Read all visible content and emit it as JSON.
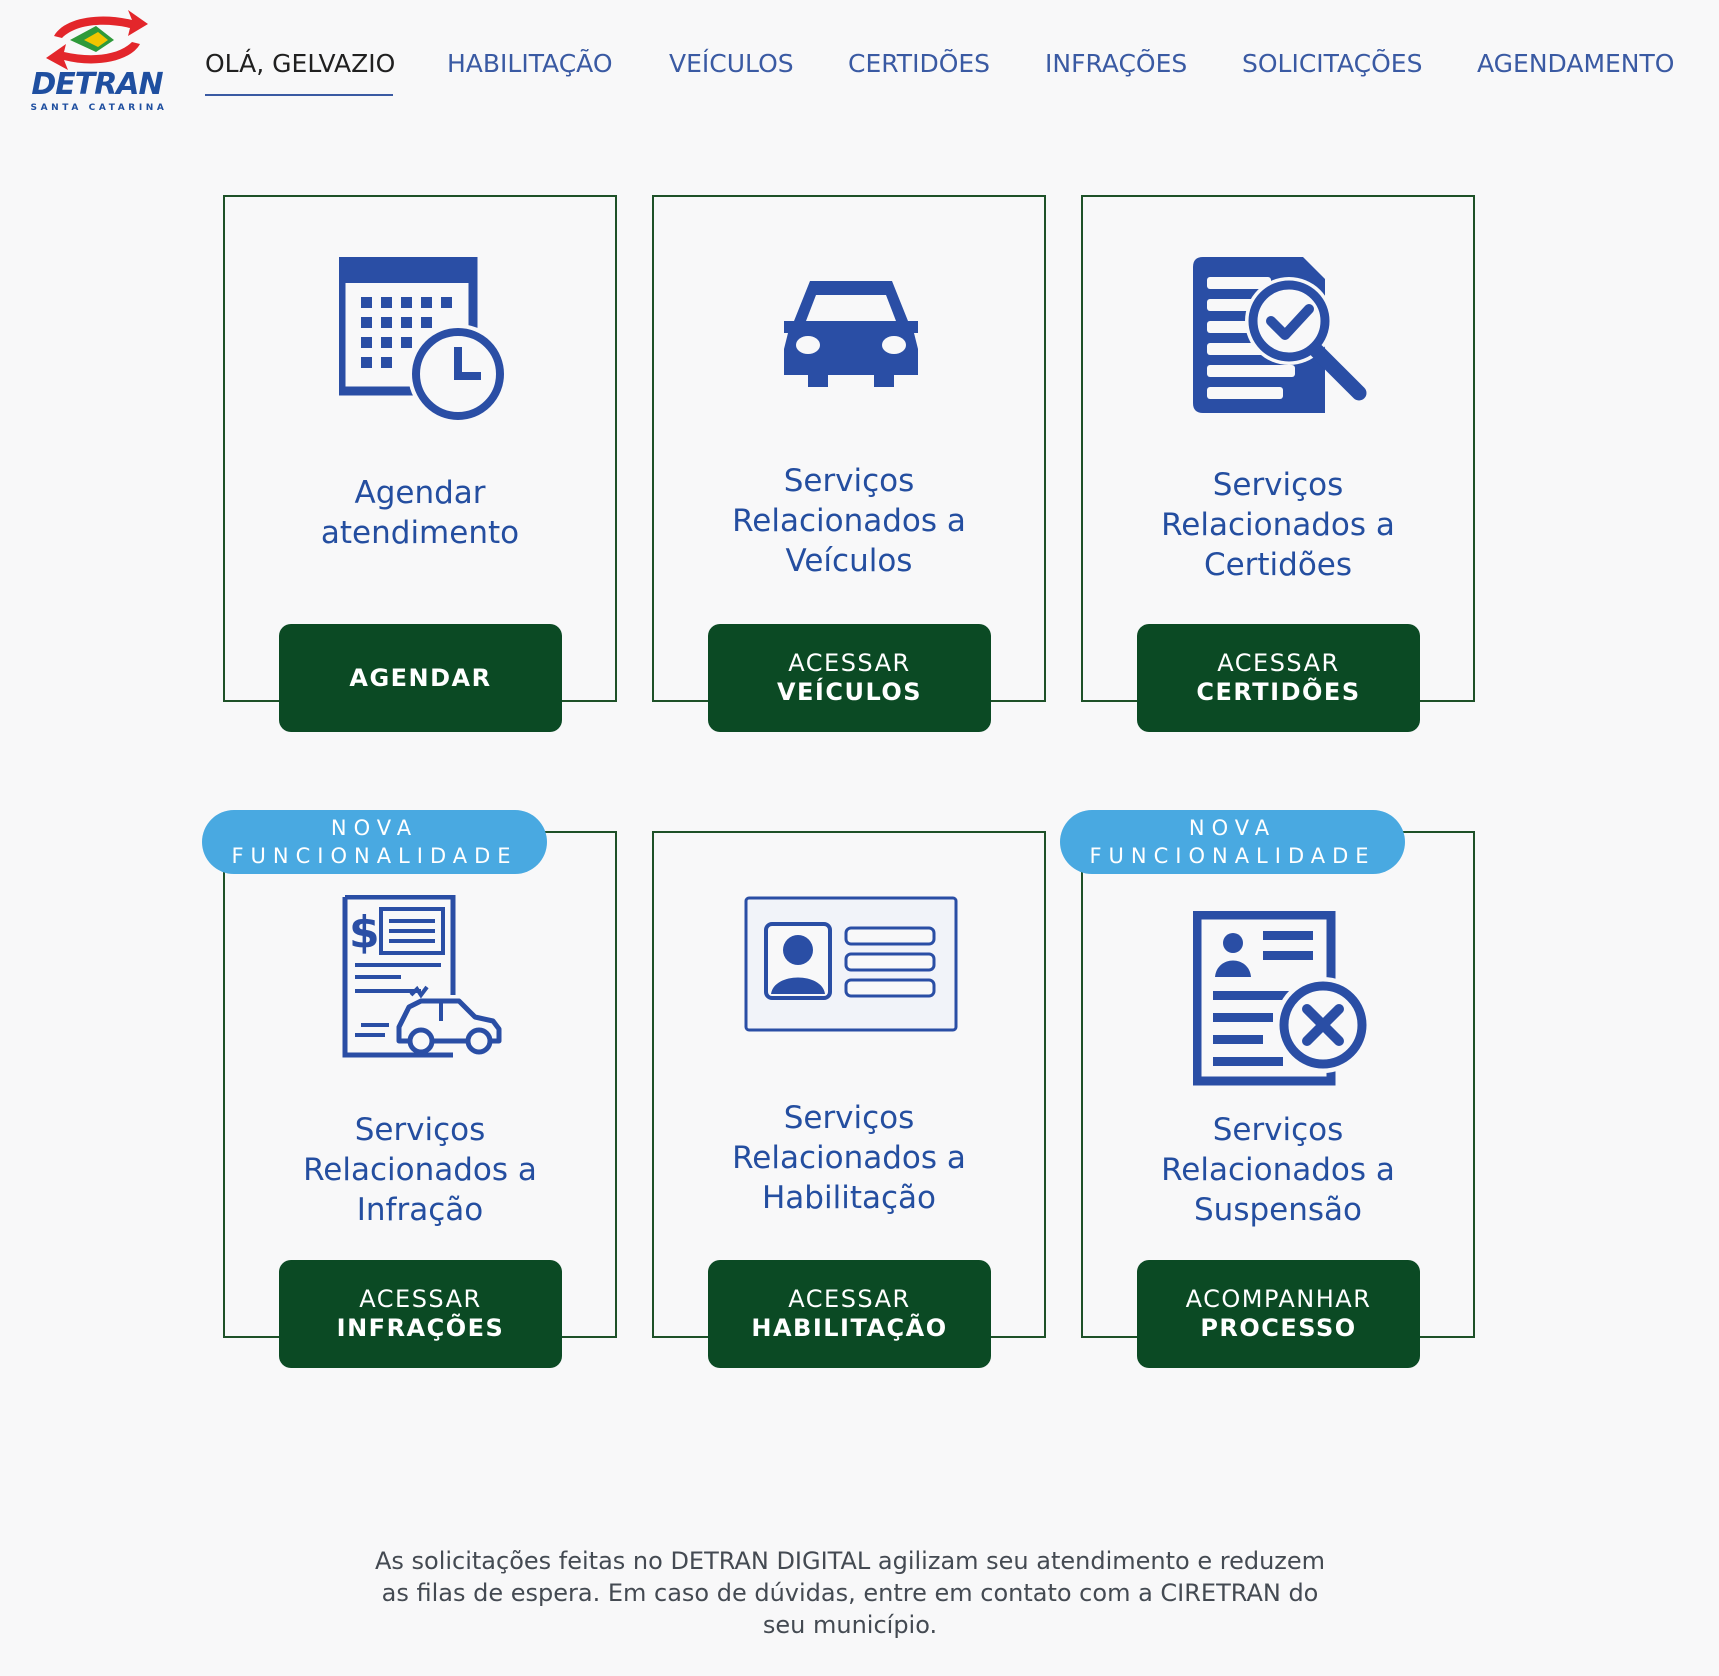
{
  "brand": {
    "name": "DETRAN",
    "subtitle": "SANTA CATARINA",
    "colors": {
      "primary": "#244ea0",
      "button": "#0b4a24",
      "badge": "#49a9e1",
      "logo_red": "#e3262b"
    }
  },
  "nav": {
    "items": [
      {
        "label": "OLÁ, GELVAZIO",
        "active": true
      },
      {
        "label": "HABILITAÇÃO"
      },
      {
        "label": "VEÍCULOS"
      },
      {
        "label": "CERTIDÕES"
      },
      {
        "label": "INFRAÇÕES"
      },
      {
        "label": "SOLICITAÇÕES"
      },
      {
        "label": "AGENDAMENTO"
      }
    ]
  },
  "cards": [
    {
      "title": [
        "Agendar",
        "atendimento"
      ],
      "button": [
        "",
        "AGENDAR"
      ],
      "icon": "calendar-clock-icon"
    },
    {
      "title": [
        "Serviços",
        "Relacionados a",
        "Veículos"
      ],
      "button": [
        "ACESSAR",
        "VEÍCULOS"
      ],
      "icon": "car-icon"
    },
    {
      "title": [
        "Serviços",
        "Relacionados a",
        "Certidões"
      ],
      "button": [
        "ACESSAR",
        "CERTIDÕES"
      ],
      "icon": "document-search-check-icon"
    },
    {
      "title": [
        "Serviços",
        "Relacionados a",
        "Infração"
      ],
      "button": [
        "ACESSAR",
        "INFRAÇÕES"
      ],
      "icon": "fine-ticket-car-icon",
      "badge": [
        "NOVA",
        "FUNCIONALIDADE"
      ]
    },
    {
      "title": [
        "Serviços",
        "Relacionados a",
        "Habilitação"
      ],
      "button": [
        "ACESSAR",
        "HABILITAÇÃO"
      ],
      "icon": "license-card-icon"
    },
    {
      "title": [
        "Serviços",
        "Relacionados a",
        "Suspensão"
      ],
      "button": [
        "ACOMPANHAR",
        "PROCESSO"
      ],
      "icon": "document-user-cancel-icon",
      "badge": [
        "NOVA",
        "FUNCIONALIDADE"
      ]
    }
  ],
  "footer": {
    "text": "As solicitações feitas no DETRAN DIGITAL agilizam seu atendimento e reduzem as filas de espera. Em caso de dúvidas, entre em contato com a CIRETRAN do seu município."
  }
}
